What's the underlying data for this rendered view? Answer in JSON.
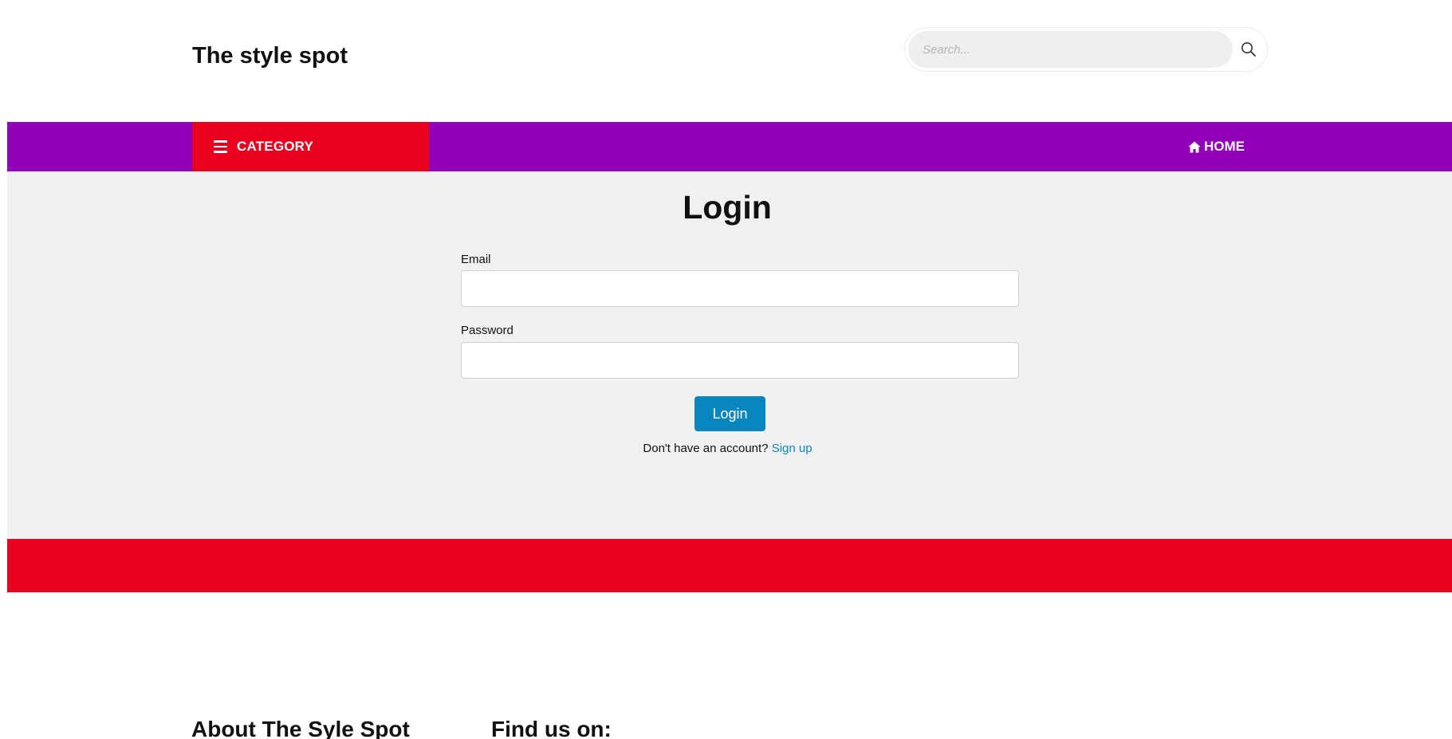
{
  "header": {
    "site_title": "The style spot",
    "search": {
      "placeholder": "Search...",
      "value": "",
      "icon": "search-icon"
    }
  },
  "nav": {
    "category_label": "CATEGORY",
    "category_icon": "hamburger-menu-icon",
    "home_label": "HOME",
    "home_icon": "home-icon",
    "bar_color": "#9200b8",
    "accent_color": "#e8001e"
  },
  "login": {
    "title": "Login",
    "email_label": "Email",
    "email_value": "",
    "password_label": "Password",
    "password_value": "",
    "submit_label": "Login",
    "prompt_text": "Don't have an account?",
    "signup_link": "Sign up",
    "button_color": "#0a86bf"
  },
  "footer": {
    "about_heading": "About The Syle Spot",
    "find_heading": "Find us on:"
  }
}
